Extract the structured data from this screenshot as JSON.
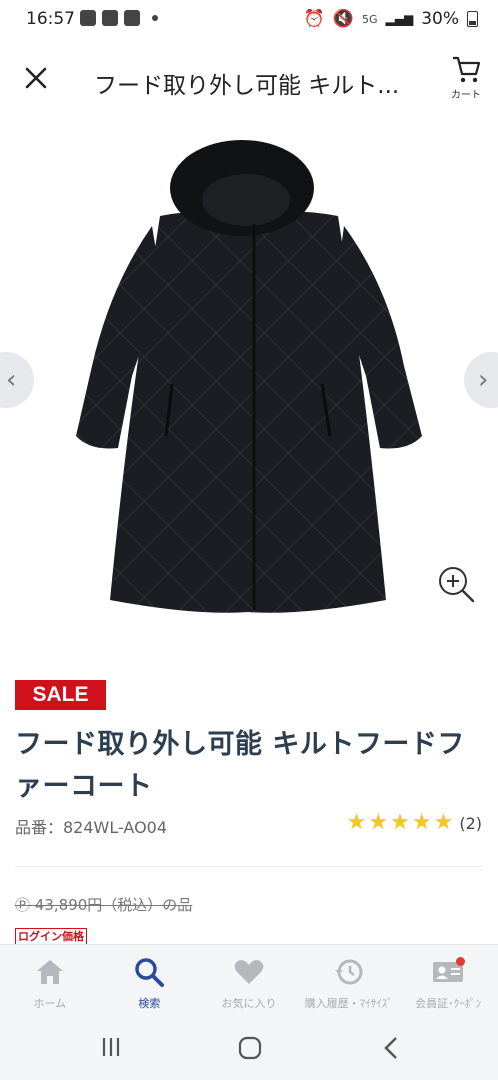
{
  "status_bar": {
    "time": "16:57",
    "signal": "5G",
    "battery": "30%"
  },
  "header": {
    "close_icon": "close-icon",
    "title": "フード取り外し可能 キルト...",
    "cart_label": "カート"
  },
  "product": {
    "sale_label": "SALE",
    "title": "フード取り外し可能 キルトフードファーコート",
    "code": "品番：824WL-AO04",
    "rating_stars": 5,
    "rating_count": "(2)",
    "old_price": "43,890円（税込）の品",
    "login_price_label": "ログイン価格"
  },
  "tabs": [
    {
      "label": "ホーム",
      "icon": "home-icon",
      "active": false
    },
    {
      "label": "検索",
      "icon": "search-icon",
      "active": true
    },
    {
      "label": "お気に入り",
      "icon": "heart-icon",
      "active": false
    },
    {
      "label": "購入履歴・ﾏｲｻｲｽﾞ",
      "icon": "history-icon",
      "active": false
    },
    {
      "label": "会員証･ｸｰﾎﾟﾝ",
      "icon": "member-card-icon",
      "active": false
    }
  ],
  "colors": {
    "sale_red": "#d0111b",
    "title_navy": "#2c3e50",
    "active_tab": "#2a4a9a",
    "star_yellow": "#f3c623"
  }
}
